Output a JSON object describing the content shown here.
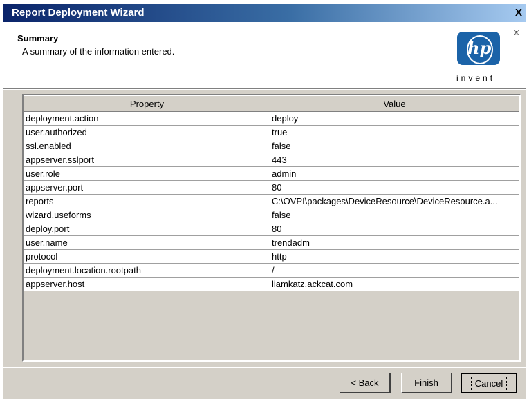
{
  "window": {
    "title": "Report Deployment Wizard",
    "close_glyph": "X"
  },
  "header": {
    "title": "Summary",
    "subtitle": "A summary of the information entered.",
    "logo": {
      "mark": "hp",
      "tagline": "invent",
      "registered": "®",
      "color": "#1b63a8"
    }
  },
  "table": {
    "columns": [
      "Property",
      "Value"
    ],
    "rows": [
      {
        "property": "deployment.action",
        "value": "deploy"
      },
      {
        "property": "user.authorized",
        "value": "true"
      },
      {
        "property": "ssl.enabled",
        "value": "false"
      },
      {
        "property": "appserver.sslport",
        "value": "443"
      },
      {
        "property": "user.role",
        "value": "admin"
      },
      {
        "property": "appserver.port",
        "value": "80"
      },
      {
        "property": "reports",
        "value": "C:\\OVPI\\packages\\DeviceResource\\DeviceResource.a..."
      },
      {
        "property": "wizard.useforms",
        "value": "false"
      },
      {
        "property": "deploy.port",
        "value": "80"
      },
      {
        "property": "user.name",
        "value": "trendadm"
      },
      {
        "property": "protocol",
        "value": "http"
      },
      {
        "property": "deployment.location.rootpath",
        "value": "/"
      },
      {
        "property": "appserver.host",
        "value": "liamkatz.ackcat.com"
      }
    ]
  },
  "buttons": {
    "back": "< Back",
    "finish": "Finish",
    "cancel": "Cancel"
  }
}
